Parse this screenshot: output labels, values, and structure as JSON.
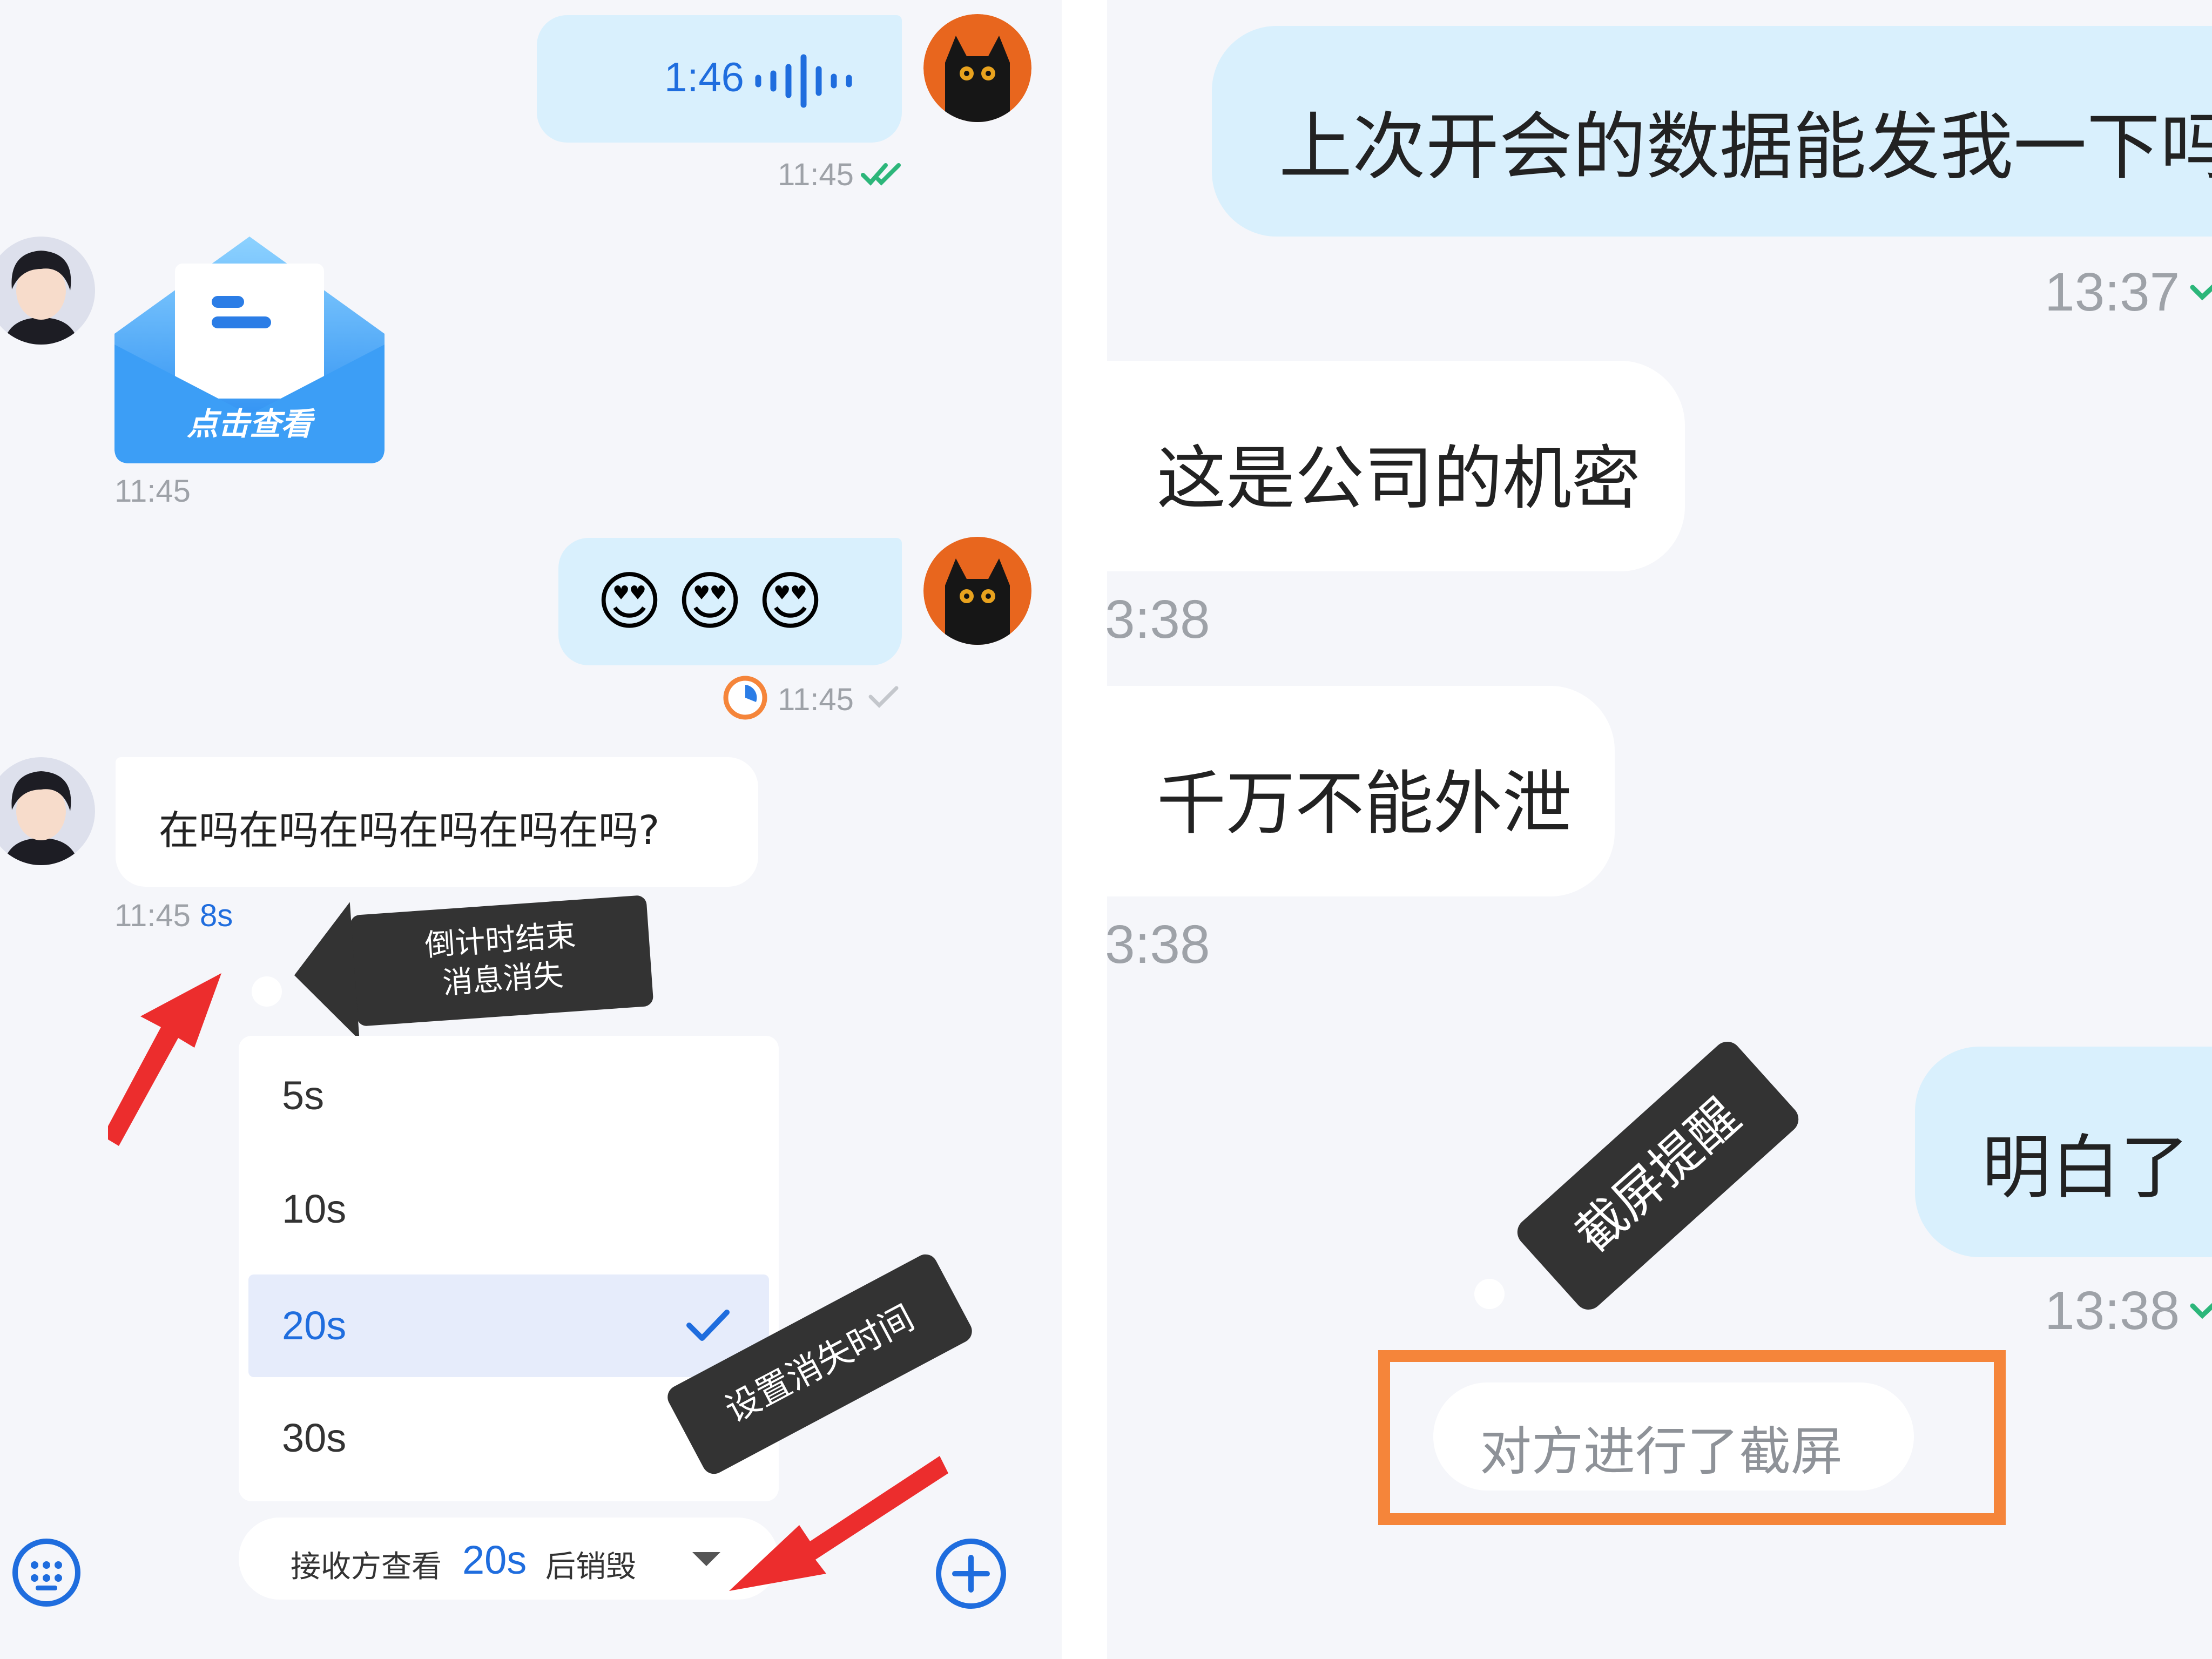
{
  "left_chat": {
    "voice_message": {
      "duration": "1:46",
      "time": "11:45",
      "status": "read"
    },
    "card_message": {
      "label": "点击查看",
      "time": "11:45"
    },
    "emoji_message": {
      "emoji": "😍😍😍",
      "time": "11:45",
      "status": "sent",
      "burn_timer": true
    },
    "text_message": {
      "text": "在吗在吗在吗在吗在吗在吗?",
      "time": "11:45",
      "countdown": "8s"
    },
    "tooltip_countdown": {
      "line1": "倒计时结束",
      "line2": "消息消失"
    },
    "tooltip_set_time": {
      "text": "设置消失时间"
    },
    "duration_menu": {
      "options": [
        "5s",
        "10s",
        "20s",
        "30s"
      ],
      "selected_index": 2
    },
    "bottom_bar": {
      "prefix": "接收方查看",
      "value": "20s",
      "suffix": "后销毁"
    }
  },
  "right_chat": {
    "messages": [
      {
        "text": "上次开会的数据能发我一下吗",
        "time": "13:37"
      },
      {
        "text": "这是公司的机密",
        "time": "3:38"
      },
      {
        "text": "千万不能外泄",
        "time": "3:38"
      },
      {
        "text": "明白了",
        "time": "13:38"
      }
    ],
    "tooltip_screenshot": {
      "text": "截屏提醒"
    },
    "system_notice": {
      "text": "对方进行了截屏"
    }
  },
  "colors": {
    "accent_blue": "#1f6dde",
    "bubble_blue": "#d9f0fd",
    "read_green": "#2cb67a",
    "highlight_orange": "#f5853a",
    "arrow_red": "#ec2d2d",
    "tooltip_dark": "#333333"
  }
}
